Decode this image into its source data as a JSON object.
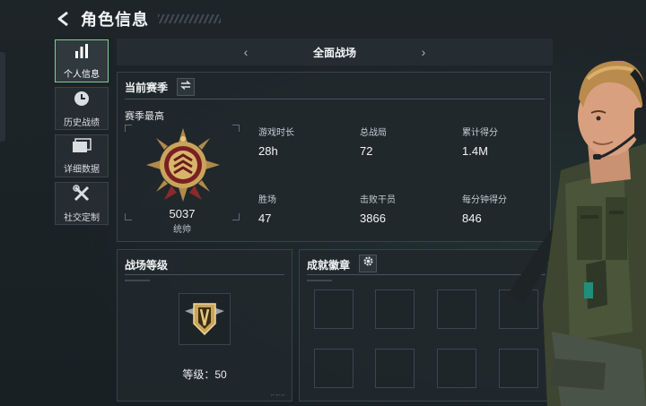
{
  "header": {
    "title": "角色信息"
  },
  "sidebar": {
    "items": [
      {
        "label": "个人信息",
        "icon": "bar-chart-icon",
        "active": true
      },
      {
        "label": "历史战绩",
        "icon": "history-clock-icon",
        "active": false
      },
      {
        "label": "详细数据",
        "icon": "folder-icon",
        "active": false
      },
      {
        "label": "社交定制",
        "icon": "tools-icon",
        "active": false
      }
    ]
  },
  "mode_selector": {
    "current": "全面战场",
    "prev_icon": "chevron-left-icon",
    "next_icon": "chevron-right-icon"
  },
  "season": {
    "title": "当前赛季",
    "subtitle": "赛季最高",
    "rank_score": "5037",
    "rank_name": "统帅",
    "stats": [
      {
        "label": "游戏时长",
        "value": "28h"
      },
      {
        "label": "总战局",
        "value": "72"
      },
      {
        "label": "累计得分",
        "value": "1.4M"
      },
      {
        "label": "胜场",
        "value": "47"
      },
      {
        "label": "击败干员",
        "value": "3866"
      },
      {
        "label": "每分钟得分",
        "value": "846"
      }
    ]
  },
  "battle_level": {
    "title": "战场等级",
    "level_text": "等级：50"
  },
  "achievements": {
    "title": "成就徽章",
    "slot_count": 8
  },
  "colors": {
    "accent": "#7ecf8e",
    "gold": "#c9a45a",
    "medal_red": "#9a2a2a"
  }
}
